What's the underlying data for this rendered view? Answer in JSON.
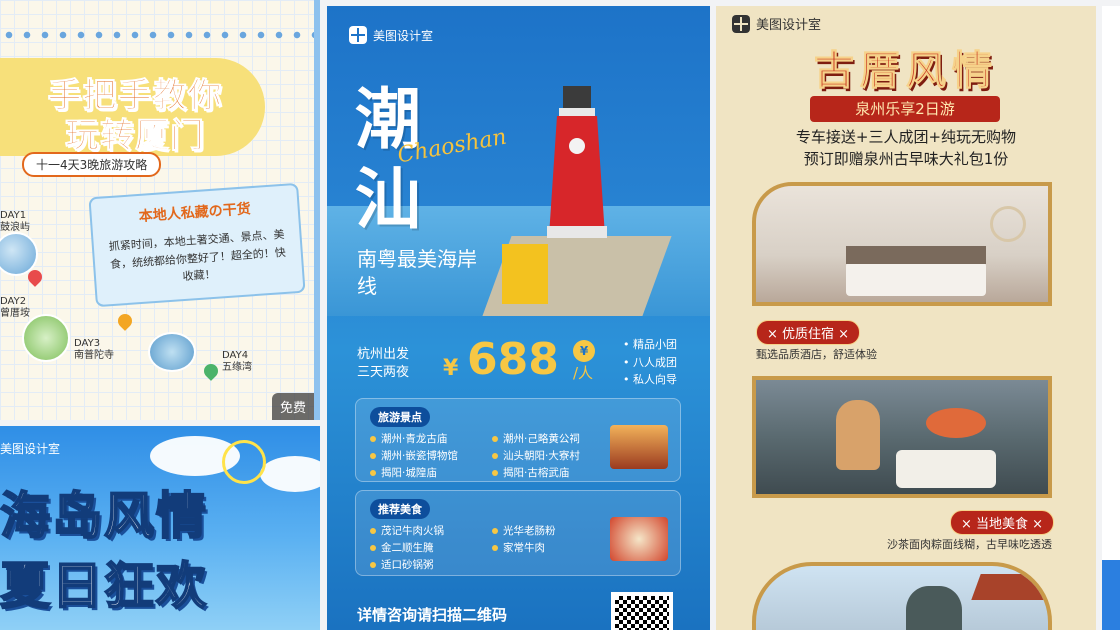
{
  "xiamen": {
    "title_line1": "手把手教你",
    "title_line2": "玩转厦门",
    "subtitle": "十一4天3晚旅游攻略",
    "note_title": "本地人私藏の干货",
    "note_text": "抓紧时间，本地土著交通、景点、美食，统统都给你整好了！超全的！快收藏！",
    "days": [
      "DAY1",
      "鼓浪屿",
      "DAY2",
      "曾厝垵",
      "DAY3",
      "南普陀寺",
      "DAY4",
      "五缘湾"
    ],
    "free_badge": "免费"
  },
  "island": {
    "brand": "美图设计室",
    "title_line1": "海岛风情",
    "title_line2": "夏日狂欢"
  },
  "chaoshan": {
    "brand": "美图设计室",
    "title_char1": "潮",
    "title_char2": "汕",
    "script": "Chaoshan",
    "subtitle": "南粤最美海岸线",
    "depart": "杭州出发",
    "duration": "三天两夜",
    "yen": "¥",
    "price": "688",
    "unit_badge": "¥",
    "unit": "/人",
    "features": [
      "精品小团",
      "八人成团",
      "私人向导"
    ],
    "spots_label": "旅游景点",
    "spots": [
      "潮州·青龙古庙",
      "潮州·己略黄公祠",
      "潮州·嵌瓷博物馆",
      "汕头朝阳·大寮村",
      "揭阳·城隍庙",
      "揭阳·古榕武庙"
    ],
    "food_label": "推荐美食",
    "foods": [
      "茂记牛肉火锅",
      "光华老肠粉",
      "金二顺生腌",
      "家常牛肉",
      "适口砂锅粥"
    ],
    "contact": "详情咨询请扫描二维码"
  },
  "quanzhou": {
    "brand": "美图设计室",
    "title": "古厝风情",
    "ribbon": "泉州乐享2日游",
    "line1": "专车接送+三人成团+纯玩无购物",
    "line2": "预订即赠泉州古早味大礼包1份",
    "tag1": "× 优质住宿 ×",
    "desc1": "甄选品质酒店，舒适体验",
    "tag2": "× 当地美食 ×",
    "desc2": "沙茶面肉粽面线糊，古早味吃透透"
  },
  "colors": {
    "accent_blue": "#1d73c8",
    "price_yellow": "#f7c744",
    "qz_red": "#b7261a"
  }
}
